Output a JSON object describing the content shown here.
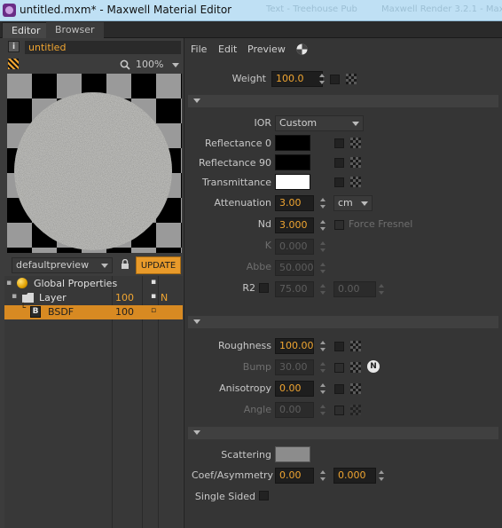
{
  "window": {
    "title": "untitled.mxm* - Maxwell Material Editor",
    "background_ghost_left": "Text - Treehouse Pub",
    "background_ghost_right": "Maxwell Render 3.2.1 - Maxwell"
  },
  "tabs": [
    {
      "label": "Editor",
      "active": true
    },
    {
      "label": "Browser",
      "active": false
    }
  ],
  "left": {
    "material_name": "untitled",
    "zoom": "100%",
    "preview_scene": "defaultpreview",
    "update_label": "UPDATE",
    "tree": [
      {
        "label": "Global Properties",
        "icon": "globe-icon",
        "weight": "",
        "flag1": "",
        "flag2": ""
      },
      {
        "label": "Layer",
        "icon": "folder-icon",
        "weight": "100",
        "flag1": "▪",
        "flag2": "N"
      },
      {
        "label": "BSDF",
        "icon": "bsdf-icon",
        "badge": "B",
        "weight": "100",
        "flag1": "▫",
        "flag2": "",
        "selected": true
      }
    ]
  },
  "menu": {
    "file": "File",
    "edit": "Edit",
    "preview": "Preview"
  },
  "weight": {
    "label": "Weight",
    "value": "100.0"
  },
  "bsdf": {
    "ior_label": "IOR",
    "ior_value": "Custom",
    "refl0_label": "Reflectance 0",
    "refl90_label": "Reflectance 90",
    "trans_label": "Transmittance",
    "atten_label": "Attenuation",
    "atten_value": "3.00",
    "atten_unit": "cm",
    "nd_label": "Nd",
    "nd_value": "3.000",
    "force_fresnel": "Force Fresnel",
    "k_label": "K",
    "k_value": "0.000",
    "abbe_label": "Abbe",
    "abbe_value": "50.000",
    "r2_label": "R2",
    "r2_value_a": "75.00",
    "r2_value_b": "0.00"
  },
  "surface": {
    "roughness_label": "Roughness",
    "roughness_value": "100.00",
    "bump_label": "Bump",
    "bump_value": "30.00",
    "normal_badge": "N",
    "aniso_label": "Anisotropy",
    "aniso_value": "0.00",
    "angle_label": "Angle",
    "angle_value": "0.00"
  },
  "sss": {
    "scattering_label": "Scattering",
    "coef_label": "Coef/Asymmetry",
    "coef_value": "0.00",
    "asym_value": "0.000",
    "single_sided_label": "Single Sided"
  },
  "colors": {
    "accent": "#f0a531",
    "selected_row": "#d88a22",
    "refl0": "#000000",
    "refl90": "#000000",
    "transmittance": "#ffffff",
    "scattering": "#8c8c8c"
  }
}
